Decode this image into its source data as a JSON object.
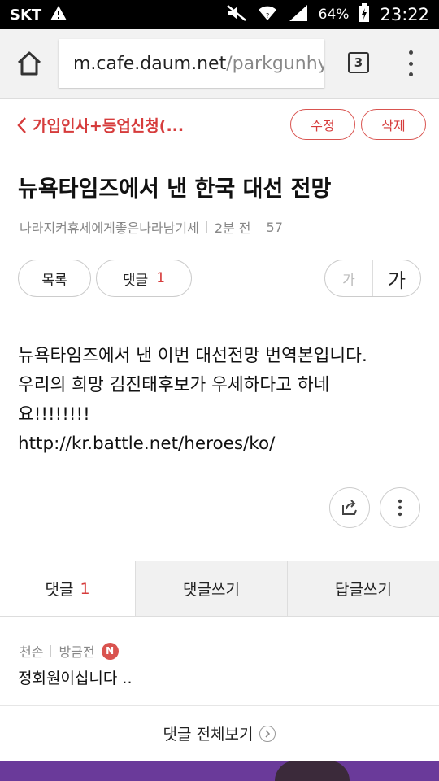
{
  "status_bar": {
    "carrier": "SKT",
    "battery": "64%",
    "time": "23:22"
  },
  "browser": {
    "url_domain": "m.cafe.daum.net",
    "url_path": "/parkgunhy",
    "tab_count": "3"
  },
  "nav": {
    "back_label": "가입인사+등업신청(...",
    "edit_label": "수정",
    "delete_label": "삭제"
  },
  "post": {
    "title": "뉴욕타임즈에서 낸 한국 대선 전망",
    "author": "나라지켜휴세에게좋은나라남기세",
    "time_ago": "2분 전",
    "views": "57",
    "list_label": "목록",
    "comment_label": "댓글",
    "comment_count": "1",
    "font_small": "가",
    "font_large": "가",
    "body_lines": [
      "뉴욕타임즈에서 낸 이번 대선전망 번역본입니다.",
      "우리의 희망 김진태후보가 우세하다고 하네",
      "요!!!!!!!!",
      "http://kr.battle.net/heroes/ko/"
    ]
  },
  "tabs": {
    "comments_label": "댓글",
    "comments_count": "1",
    "write_label": "댓글쓰기",
    "reply_label": "답글쓰기"
  },
  "comment": {
    "author": "천손",
    "time": "방금전",
    "badge": "N",
    "text": "정회원이십니다 .."
  },
  "view_all_label": "댓글 전체보기",
  "colors": {
    "accent_red": "#d63c3c",
    "banner_purple": "#6a3a9a"
  }
}
